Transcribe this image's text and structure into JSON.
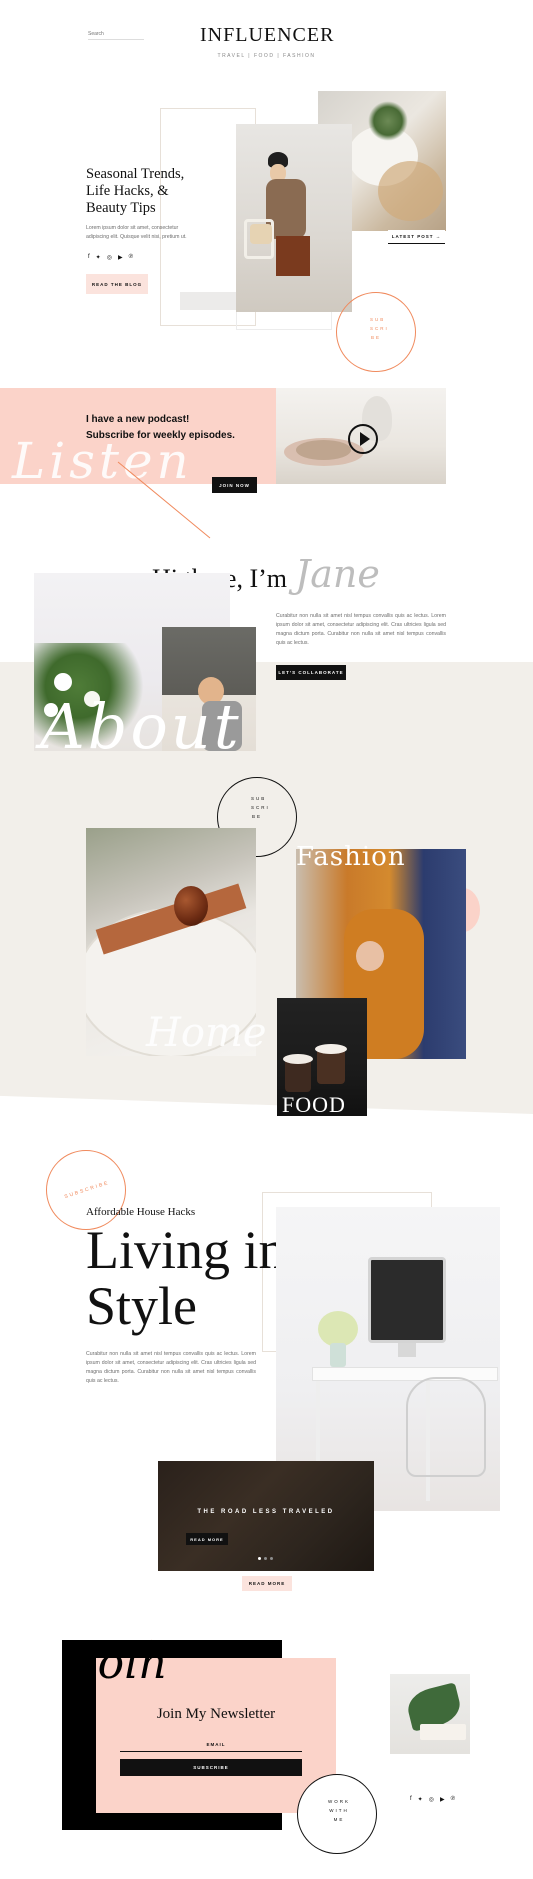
{
  "header": {
    "search_placeholder": "Search",
    "logo": "INFLUENCER",
    "tagline": "TRAVEL  |  FOOD  |  FASHION"
  },
  "hero": {
    "title": "Seasonal Trends, Life Hacks, & Beauty Tips",
    "body": "Lorem ipsum dolor sit amet, consectetur adipiscing elit. Quisque velit nisi, pretium ut.",
    "button": "READ THE BLOG",
    "latest_post": "LATEST POST →",
    "subscribe_circle": "SUB SCRI BE"
  },
  "podcast": {
    "line1": "I have a new podcast!",
    "line2": "Subscribe for weekly episodes.",
    "button": "JOIN NOW",
    "script_word": "Listen"
  },
  "about": {
    "greeting": "Hi there, I’m",
    "name": "Jane",
    "body": "Curabitur non nulla sit amet nisl tempus convallis quis ac lectus. Lorem ipsum dolor sit amet, consectetur adipiscing elit. Cras ultricies ligula sed magna dictum porta. Curabitur non nulla sit amet nisl tempus convallis quis ac lectus.",
    "button": "LET’S COLLABORATE",
    "script_word": "About",
    "subscribe_circle": "SUB SCRI BE"
  },
  "categories": {
    "fashion": "Fashion",
    "home": "Home",
    "food": "FOOD"
  },
  "living": {
    "subscribe_circle": "SUBSCRIBE",
    "kicker": "Affordable House Hacks",
    "title_line1": "Living in",
    "title_line2": "Style",
    "body": "Curabitur non nulla sit amet nisl tempus convallis quis ac lectus. Lorem ipsum dolor sit amet, consectetur adipiscing elit. Cras ultricies ligula sed magna dictum porta. Curabitur non nulla sit amet nisl tempus convallis quis ac lectus.",
    "slider_caption": "THE ROAD LESS TRAVELED",
    "slider_button": "READ MORE",
    "read_more": "READ MORE"
  },
  "newsletter": {
    "script_word": "Join",
    "title": "Join My Newsletter",
    "email_label": "EMAIL",
    "button": "SUBSCRIBE",
    "work_circle": "WORK WITH ME"
  },
  "social_icons": [
    "facebook-icon",
    "twitter-icon",
    "instagram-icon",
    "youtube-icon",
    "pinterest-icon"
  ],
  "colors": {
    "accent": "#f08a5d",
    "pink": "#fbd3c9",
    "beige": "#f2efea",
    "black": "#111111"
  }
}
